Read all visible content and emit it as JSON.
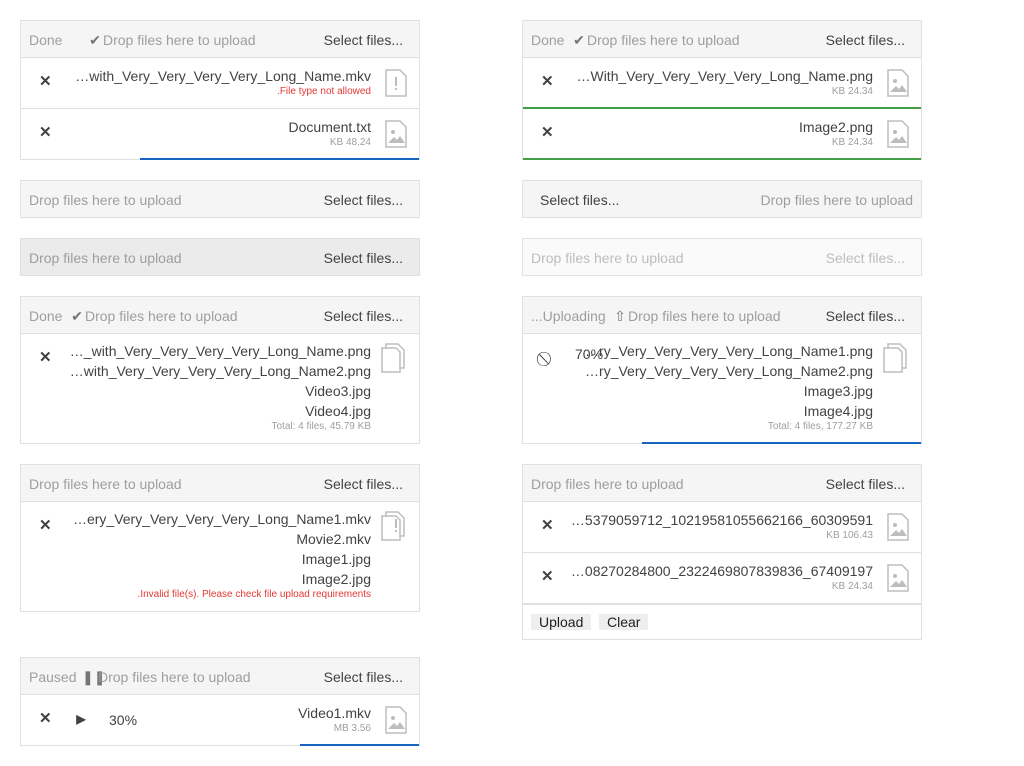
{
  "u1": {
    "status": "Done",
    "hint": "Drop files here to upload",
    "select": "Select files...",
    "f1_name": "…with_Very_Very_Very_Very_Long_Name.mkv",
    "f1_err": ".File type not allowed",
    "f2_name": "Document.txt",
    "f2_size": "KB 48.24"
  },
  "u2": {
    "status": "Done",
    "hint": "Drop files here to upload",
    "select": "Select files...",
    "f1_name": "…With_Very_Very_Very_Very_Long_Name.png",
    "f1_size": "KB 24.34",
    "f2_name": "Image2.png",
    "f2_size": "KB 24.34"
  },
  "u3": {
    "hint": "Drop files here to upload",
    "select": "Select files..."
  },
  "u4": {
    "hint": "Drop files here to upload",
    "select": "Select files..."
  },
  "u5": {
    "hint": "Drop files here to upload",
    "select": "Select files..."
  },
  "u6": {
    "hint": "Drop files here to upload",
    "select": "Select files..."
  },
  "u7": {
    "status": "Done",
    "hint": "Drop files here to upload",
    "select": "Select files...",
    "files": [
      "…_with_Very_Very_Very_Very_Long_Name.png",
      "…with_Very_Very_Very_Very_Long_Name2.png",
      "Video3.jpg",
      "Video4.jpg"
    ],
    "total": "Total: 4 files, 45.79 KB"
  },
  "u8": {
    "status": "...Uploading",
    "hint": "Drop files here to upload",
    "select": "Select files...",
    "percent": "70%",
    "files": [
      "…ry_Very_Very_Very_Very_Long_Name1.png",
      "…ry_Very_Very_Very_Very_Long_Name2.png",
      "Image3.jpg",
      "Image4.jpg"
    ],
    "total": "Total: 4 files, 177.27 KB"
  },
  "u9": {
    "hint": "Drop files here to upload",
    "select": "Select files...",
    "files": [
      "…ery_Very_Very_Very_Very_Long_Name1.mkv",
      "Movie2.mkv",
      "Image1.jpg",
      "Image2.jpg"
    ],
    "error": ".Invalid file(s). Please check file upload requirements"
  },
  "u10": {
    "hint": "Drop files here to upload",
    "select": "Select files...",
    "f1_name": "…5379059712_10219581055662166_60309591",
    "f1_size": "KB 106.43",
    "f2_name": "…08270284800_2322469807839836_67409197",
    "f2_size": "KB 24.34",
    "upload": "Upload",
    "clear": "Clear"
  },
  "u11": {
    "status": "Paused",
    "hint": "Drop files here to upload",
    "select": "Select files...",
    "percent": "30%",
    "f_name": "Video1.mkv",
    "f_size": "MB 3.56"
  },
  "progress": {
    "u1_file2": 0.7,
    "u8_total": 0.7,
    "u11_file": 0.3
  },
  "colors": {
    "progress": "#1565c0",
    "success": "#43a047",
    "error": "#e53935"
  }
}
